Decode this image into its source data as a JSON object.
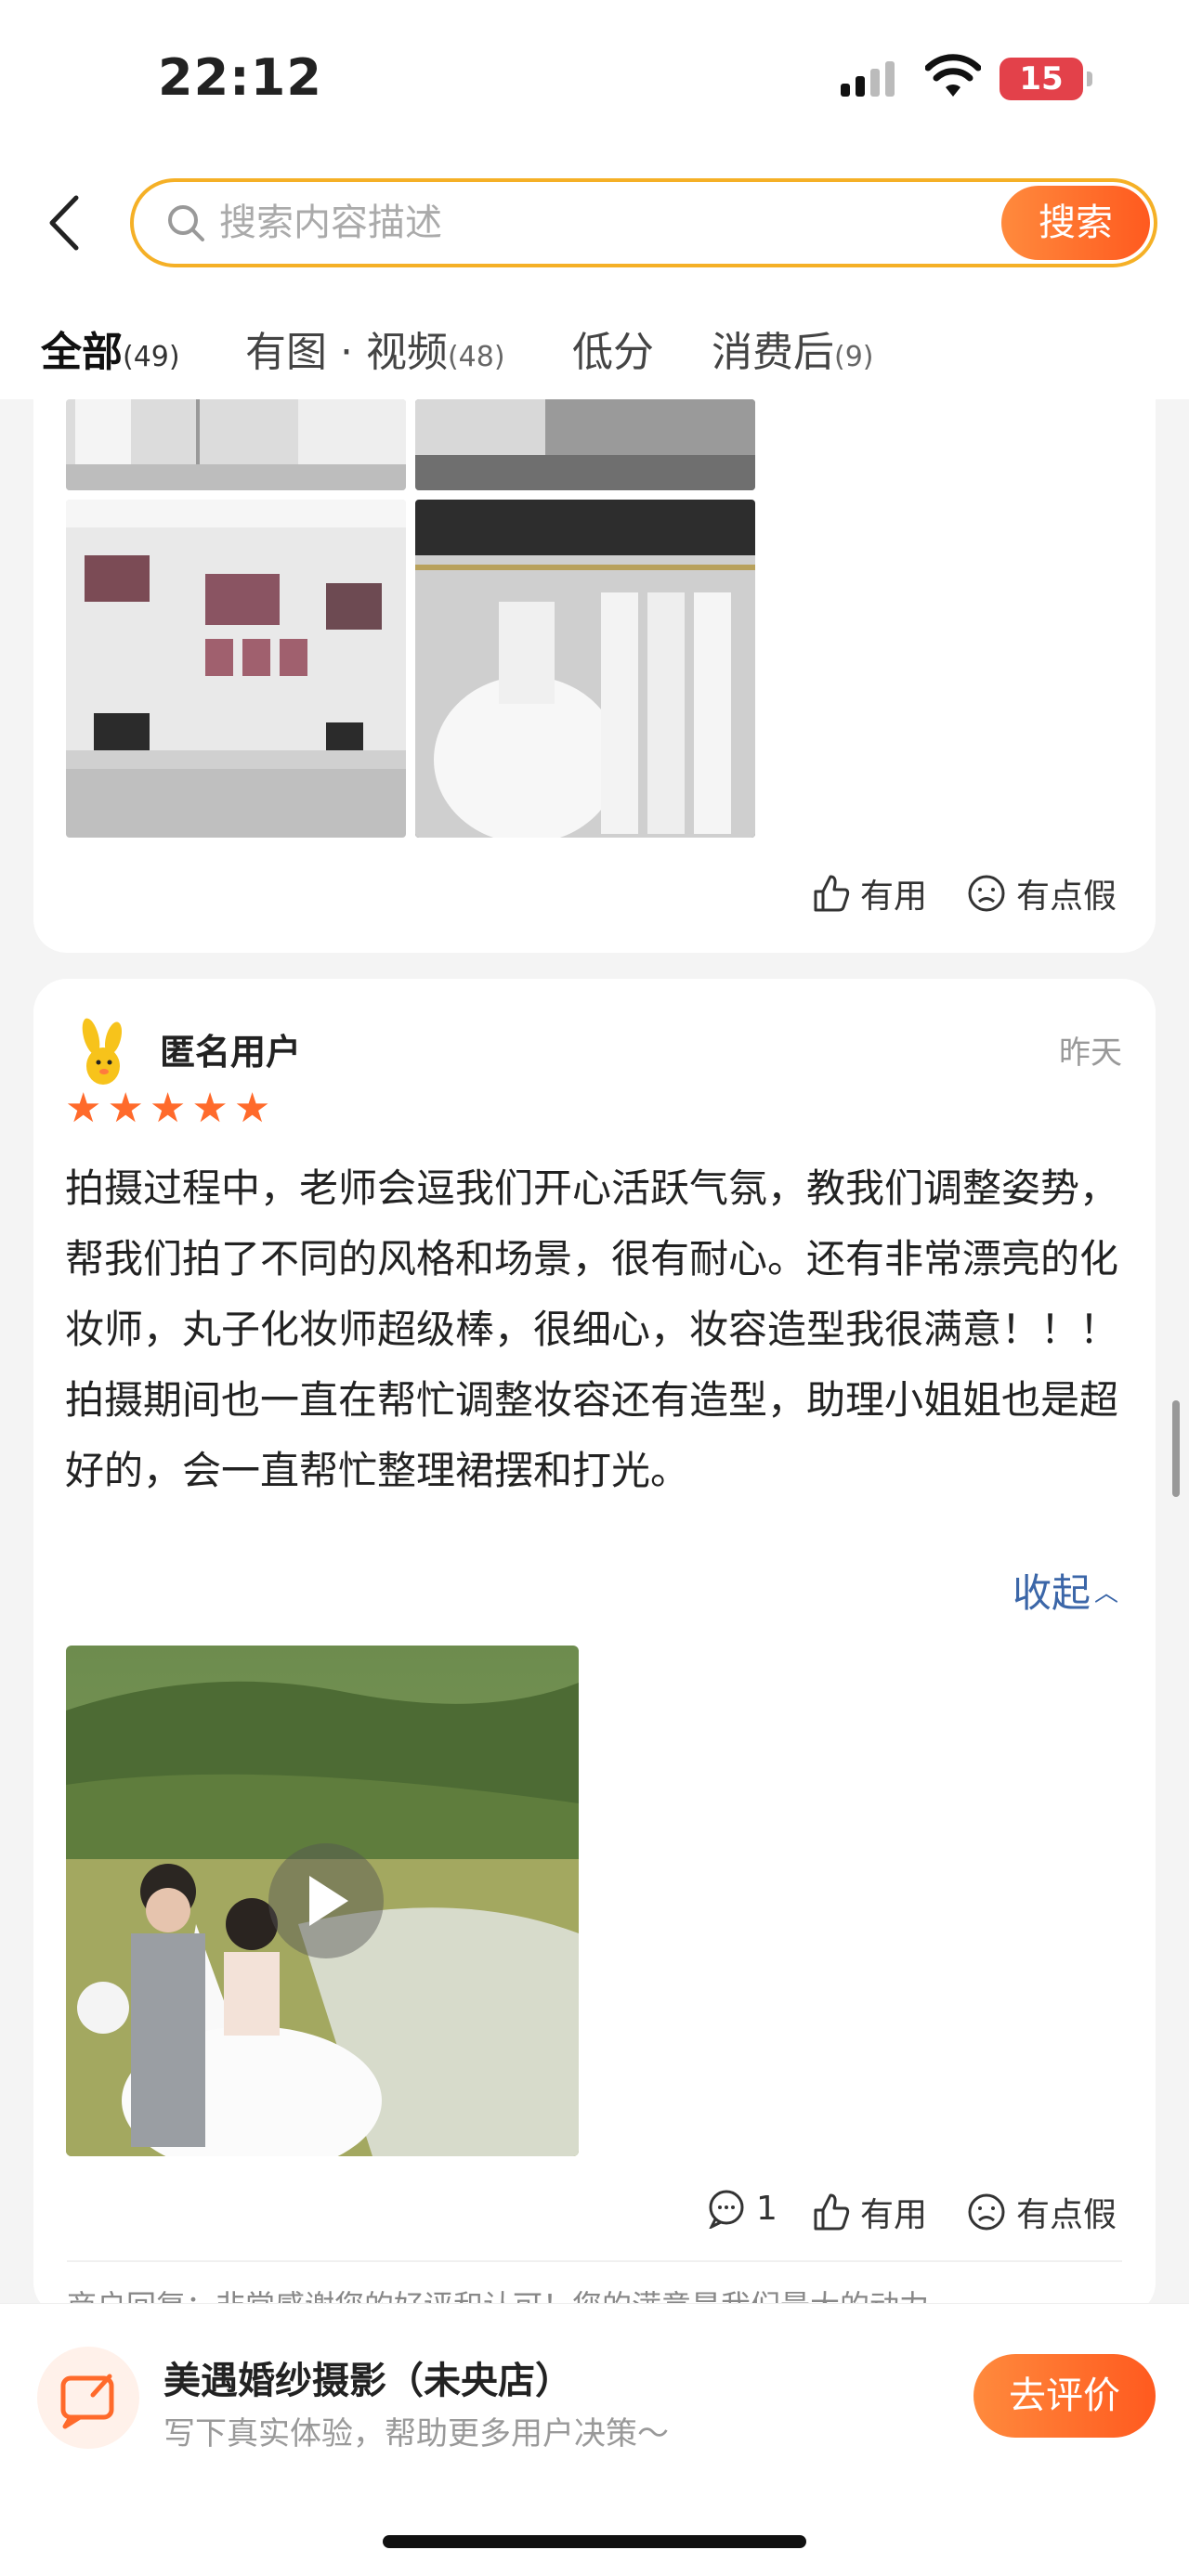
{
  "status_bar": {
    "time": "22:12",
    "battery": "15"
  },
  "search": {
    "placeholder": "搜索内容描述",
    "button": "搜索"
  },
  "tabs": [
    {
      "label": "全部",
      "count": "(49)"
    },
    {
      "label": "有图 · 视频",
      "count": "(48)"
    },
    {
      "label": "低分",
      "count": ""
    },
    {
      "label": "消费后",
      "count": "(9)"
    }
  ],
  "prev_review": {
    "helpful": "有用",
    "fake": "有点假"
  },
  "review": {
    "user": "匿名用户",
    "date": "昨天",
    "rating": 5,
    "text": "拍摄过程中，老师会逗我们开心活跃气氛，教我们调整姿势，帮我们拍了不同的风格和场景，很有耐心。还有非常漂亮的化妆师，丸子化妆师超级棒，很细心，妆容造型我很满意！！！拍摄期间也一直在帮忙调整妆容还有造型，助理小姐姐也是超好的，会一直帮忙整理裙摆和打光。",
    "collapse": "收起",
    "comments": "1",
    "helpful": "有用",
    "fake": "有点假",
    "merchant_reply": "商户回复：非常感谢您的好评和认可！您的满意是我们最大的动力"
  },
  "bottom": {
    "shop_name": "美遇婚纱摄影（未央店）",
    "subtitle": "写下真实体验，帮助更多用户决策～",
    "button": "去评价"
  }
}
